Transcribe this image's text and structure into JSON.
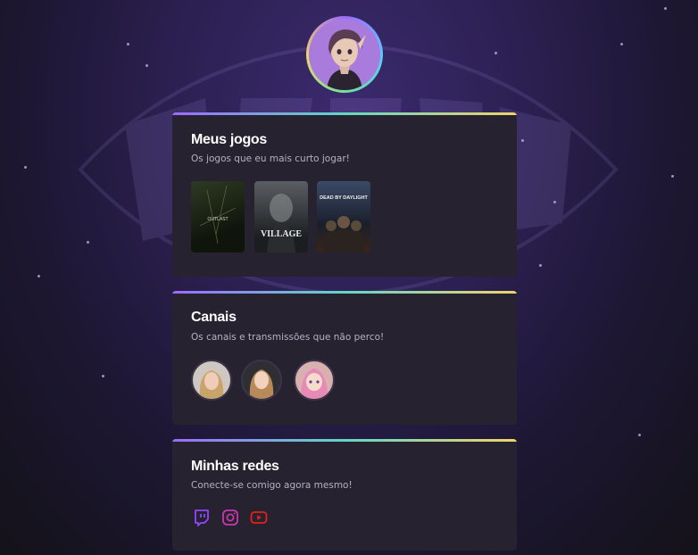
{
  "profile": {
    "avatar_icon": "profile-avatar-illustration"
  },
  "games": {
    "title": "Meus jogos",
    "subtitle": "Os jogos que eu mais curto jogar!",
    "items": [
      {
        "name": "Outlast",
        "cover_text": "OUTLAST"
      },
      {
        "name": "Resident Evil Village",
        "cover_text": "VILLAGE"
      },
      {
        "name": "Dead by Daylight",
        "cover_text": "DEAD BY DAYLIGHT"
      }
    ]
  },
  "channels": {
    "title": "Canais",
    "subtitle": "Os canais e transmissões que não perco!",
    "items": [
      {
        "avatar": "channel-avatar-1"
      },
      {
        "avatar": "channel-avatar-2"
      },
      {
        "avatar": "channel-avatar-3"
      }
    ]
  },
  "socials": {
    "title": "Minhas redes",
    "subtitle": "Conecte-se comigo agora mesmo!",
    "items": [
      {
        "icon": "twitch-icon",
        "color": "#9146ff"
      },
      {
        "icon": "instagram-icon",
        "color": "#c837ab"
      },
      {
        "icon": "youtube-icon",
        "color": "#e62117"
      }
    ]
  }
}
